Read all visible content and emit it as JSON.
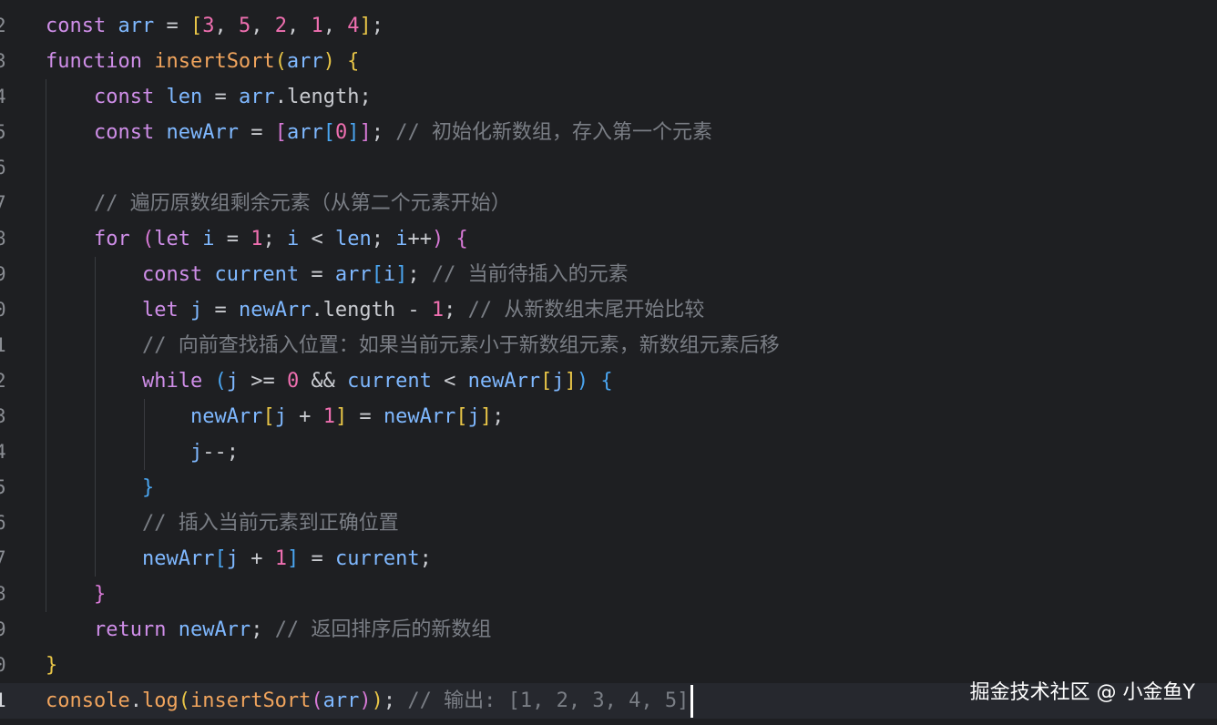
{
  "editor": {
    "lines": [
      {
        "no": "2",
        "code": [
          [
            "kw",
            "const "
          ],
          [
            "var",
            "arr"
          ],
          [
            "op",
            " = "
          ],
          [
            "p1",
            "["
          ],
          [
            "num",
            "3"
          ],
          [
            "op",
            ", "
          ],
          [
            "num",
            "5"
          ],
          [
            "op",
            ", "
          ],
          [
            "num",
            "2"
          ],
          [
            "op",
            ", "
          ],
          [
            "num",
            "1"
          ],
          [
            "op",
            ", "
          ],
          [
            "num",
            "4"
          ],
          [
            "p1",
            "]"
          ],
          [
            "op",
            ";"
          ]
        ]
      },
      {
        "no": "3",
        "code": [
          [
            "kw",
            "function "
          ],
          [
            "fn",
            "insertSort"
          ],
          [
            "p1",
            "("
          ],
          [
            "var",
            "arr"
          ],
          [
            "p1",
            ")"
          ],
          [
            "op",
            " "
          ],
          [
            "p1",
            "{"
          ]
        ]
      },
      {
        "no": "4",
        "code": [
          [
            "op",
            "    "
          ],
          [
            "kw",
            "const "
          ],
          [
            "var",
            "len"
          ],
          [
            "op",
            " = "
          ],
          [
            "var",
            "arr"
          ],
          [
            "op",
            "."
          ],
          [
            "op",
            "length;"
          ]
        ]
      },
      {
        "no": "5",
        "code": [
          [
            "op",
            "    "
          ],
          [
            "kw",
            "const "
          ],
          [
            "var",
            "newArr"
          ],
          [
            "op",
            " = "
          ],
          [
            "p2",
            "["
          ],
          [
            "var",
            "arr"
          ],
          [
            "p3",
            "["
          ],
          [
            "num",
            "0"
          ],
          [
            "p3",
            "]"
          ],
          [
            "p2",
            "]"
          ],
          [
            "op",
            "; "
          ],
          [
            "cm",
            "// 初始化新数组，存入第一个元素"
          ]
        ]
      },
      {
        "no": "6",
        "code": []
      },
      {
        "no": "7",
        "code": [
          [
            "op",
            "    "
          ],
          [
            "cm",
            "// 遍历原数组剩余元素（从第二个元素开始）"
          ]
        ]
      },
      {
        "no": "8",
        "code": [
          [
            "op",
            "    "
          ],
          [
            "kw",
            "for "
          ],
          [
            "p2",
            "("
          ],
          [
            "kw",
            "let "
          ],
          [
            "var",
            "i"
          ],
          [
            "op",
            " = "
          ],
          [
            "num",
            "1"
          ],
          [
            "op",
            "; "
          ],
          [
            "var",
            "i"
          ],
          [
            "op",
            " < "
          ],
          [
            "var",
            "len"
          ],
          [
            "op",
            "; "
          ],
          [
            "var",
            "i"
          ],
          [
            "op",
            "++"
          ],
          [
            "p2",
            ")"
          ],
          [
            "op",
            " "
          ],
          [
            "p2",
            "{"
          ]
        ]
      },
      {
        "no": "9",
        "code": [
          [
            "op",
            "        "
          ],
          [
            "kw",
            "const "
          ],
          [
            "var",
            "current"
          ],
          [
            "op",
            " = "
          ],
          [
            "var",
            "arr"
          ],
          [
            "p3",
            "["
          ],
          [
            "var",
            "i"
          ],
          [
            "p3",
            "]"
          ],
          [
            "op",
            "; "
          ],
          [
            "cm",
            "// 当前待插入的元素"
          ]
        ]
      },
      {
        "no": "0",
        "code": [
          [
            "op",
            "        "
          ],
          [
            "kw",
            "let "
          ],
          [
            "var",
            "j"
          ],
          [
            "op",
            " = "
          ],
          [
            "var",
            "newArr"
          ],
          [
            "op",
            ".length - "
          ],
          [
            "num",
            "1"
          ],
          [
            "op",
            "; "
          ],
          [
            "cm",
            "// 从新数组末尾开始比较"
          ]
        ]
      },
      {
        "no": "1",
        "code": [
          [
            "op",
            "        "
          ],
          [
            "cm",
            "// 向前查找插入位置：如果当前元素小于新数组元素，新数组元素后移"
          ]
        ]
      },
      {
        "no": "2",
        "code": [
          [
            "op",
            "        "
          ],
          [
            "kw",
            "while "
          ],
          [
            "p3",
            "("
          ],
          [
            "var",
            "j"
          ],
          [
            "op",
            " >= "
          ],
          [
            "num",
            "0"
          ],
          [
            "op",
            " && "
          ],
          [
            "var",
            "current"
          ],
          [
            "op",
            " < "
          ],
          [
            "var",
            "newArr"
          ],
          [
            "p1",
            "["
          ],
          [
            "var",
            "j"
          ],
          [
            "p1",
            "]"
          ],
          [
            "p3",
            ")"
          ],
          [
            "op",
            " "
          ],
          [
            "p3",
            "{"
          ]
        ]
      },
      {
        "no": "3",
        "code": [
          [
            "op",
            "            "
          ],
          [
            "var",
            "newArr"
          ],
          [
            "p1",
            "["
          ],
          [
            "var",
            "j"
          ],
          [
            "op",
            " + "
          ],
          [
            "num",
            "1"
          ],
          [
            "p1",
            "]"
          ],
          [
            "op",
            " = "
          ],
          [
            "var",
            "newArr"
          ],
          [
            "p1",
            "["
          ],
          [
            "var",
            "j"
          ],
          [
            "p1",
            "]"
          ],
          [
            "op",
            ";"
          ]
        ]
      },
      {
        "no": "4",
        "code": [
          [
            "op",
            "            "
          ],
          [
            "var",
            "j"
          ],
          [
            "op",
            "--;"
          ]
        ]
      },
      {
        "no": "5",
        "code": [
          [
            "op",
            "        "
          ],
          [
            "p3",
            "}"
          ]
        ]
      },
      {
        "no": "6",
        "code": [
          [
            "op",
            "        "
          ],
          [
            "cm",
            "// 插入当前元素到正确位置"
          ]
        ]
      },
      {
        "no": "7",
        "code": [
          [
            "op",
            "        "
          ],
          [
            "var",
            "newArr"
          ],
          [
            "p3",
            "["
          ],
          [
            "var",
            "j"
          ],
          [
            "op",
            " + "
          ],
          [
            "num",
            "1"
          ],
          [
            "p3",
            "]"
          ],
          [
            "op",
            " = "
          ],
          [
            "var",
            "current"
          ],
          [
            "op",
            ";"
          ]
        ]
      },
      {
        "no": "8",
        "code": [
          [
            "op",
            "    "
          ],
          [
            "p2",
            "}"
          ]
        ]
      },
      {
        "no": "9",
        "code": [
          [
            "op",
            "    "
          ],
          [
            "kw",
            "return "
          ],
          [
            "var",
            "newArr"
          ],
          [
            "op",
            "; "
          ],
          [
            "cm",
            "// 返回排序后的新数组"
          ]
        ]
      },
      {
        "no": "0",
        "code": [
          [
            "p1",
            "}"
          ]
        ]
      },
      {
        "no": "1",
        "code": [
          [
            "fn",
            "console"
          ],
          [
            "op",
            "."
          ],
          [
            "fn",
            "log"
          ],
          [
            "p1",
            "("
          ],
          [
            "fn",
            "insertSort"
          ],
          [
            "p2",
            "("
          ],
          [
            "var",
            "arr"
          ],
          [
            "p2",
            ")"
          ],
          [
            "p1",
            ")"
          ],
          [
            "op",
            "; "
          ],
          [
            "cm",
            "// 输出: [1, 2, 3, 4, 5]"
          ]
        ],
        "current": true
      }
    ]
  },
  "watermark": "掘金技术社区 @ 小金鱼Y"
}
